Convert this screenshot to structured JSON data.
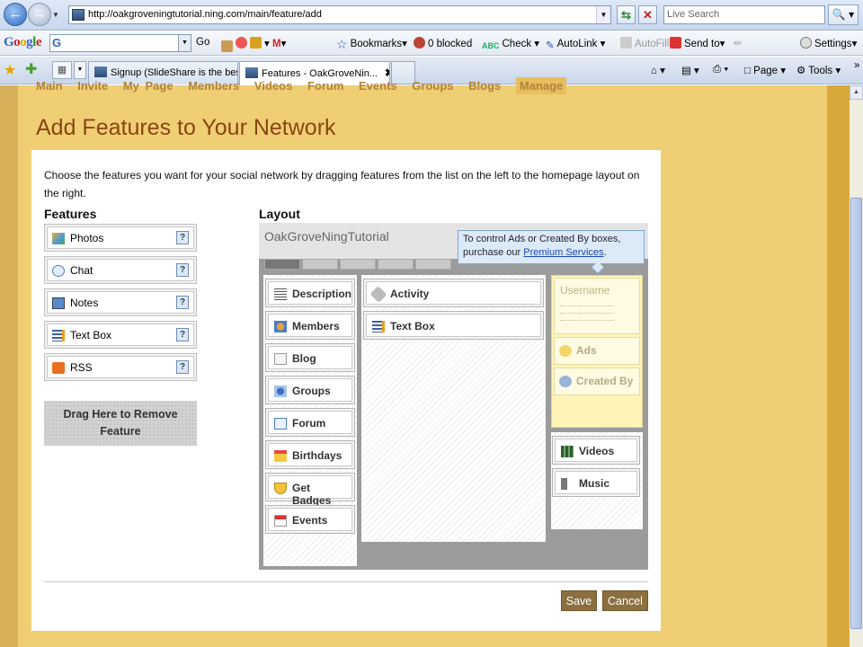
{
  "browser": {
    "url": "http://oakgroveningtutorial.ning.com/main/feature/add",
    "search_placeholder": "Live Search",
    "google_toolbar": {
      "logo": "Google",
      "g_label": "G",
      "go": "Go",
      "bookmarks": "Bookmarks",
      "blocked": "0 blocked",
      "check": "Check",
      "autolink": "AutoLink",
      "autofill": "AutoFill",
      "sendto": "Send to",
      "settings": "Settings"
    },
    "tabs": [
      {
        "label": "Signup (SlideShare is the bes..."
      },
      {
        "label": "Features - OakGroveNin...",
        "close": "✖"
      }
    ],
    "commands": {
      "page": "Page",
      "tools": "Tools"
    }
  },
  "site_nav": {
    "items": [
      "Main",
      "Invite",
      "My Page",
      "Members",
      "Videos",
      "Forum",
      "Events",
      "Groups",
      "Blogs"
    ],
    "active": "Manage"
  },
  "page": {
    "title": "Add Features to Your Network",
    "intro": "Choose the features you want for your social network by dragging features from the list on the left to the homepage layout on the right.",
    "features_heading": "Features",
    "layout_heading": "Layout",
    "features": [
      {
        "label": "Photos",
        "icon": "photos-icon"
      },
      {
        "label": "Chat",
        "icon": "chat-icon"
      },
      {
        "label": "Notes",
        "icon": "notes-icon"
      },
      {
        "label": "Text Box",
        "icon": "text-box-icon"
      },
      {
        "label": "RSS",
        "icon": "rss-icon"
      }
    ],
    "help_glyph": "?",
    "remove_zone": "Drag Here to Remove Feature",
    "layout": {
      "network_name": "OakGroveNingTutorial",
      "callout_text": "To control Ads or Created By boxes, purchase our ",
      "callout_link": "Premium Services",
      "callout_end": ".",
      "left_column": [
        "Description",
        "Members",
        "Blog",
        "Groups",
        "Forum",
        "Birthdays",
        "Get Badges",
        "Events"
      ],
      "middle_column": [
        "Activity",
        "Text Box"
      ],
      "right_locked": {
        "username": "Username",
        "ads": "Ads",
        "created_by": "Created By"
      },
      "right_column": [
        "Videos",
        "Music"
      ]
    },
    "save_label": "Save",
    "cancel_label": "Cancel"
  }
}
